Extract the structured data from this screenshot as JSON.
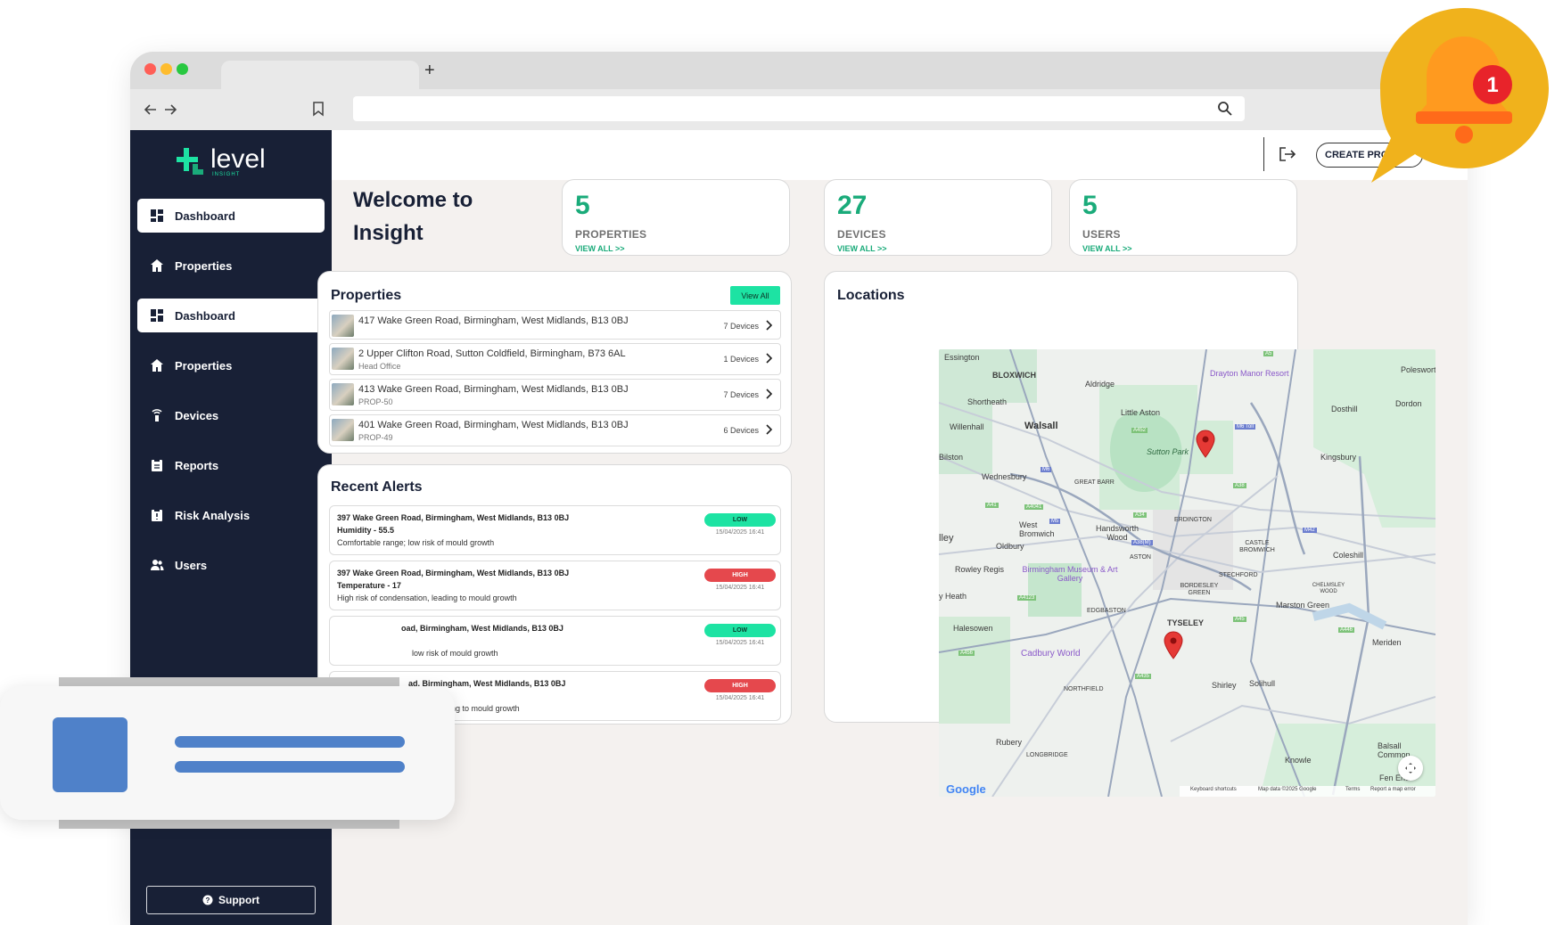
{
  "browser": {
    "new_tab_symbol": "+"
  },
  "brand": {
    "name": "level",
    "tagline": "INSIGHT"
  },
  "sidebar": {
    "items": [
      {
        "label": "Dashboard",
        "icon": "grid-icon",
        "active": true
      },
      {
        "label": "Properties",
        "icon": "home-icon",
        "active": false
      },
      {
        "label": "Dashboard",
        "icon": "grid-icon",
        "active": true
      },
      {
        "label": "Properties",
        "icon": "home-icon",
        "active": false
      },
      {
        "label": "Devices",
        "icon": "device-icon",
        "active": false
      },
      {
        "label": "Reports",
        "icon": "report-icon",
        "active": false
      },
      {
        "label": "Risk Analysis",
        "icon": "risk-icon",
        "active": false
      },
      {
        "label": "Users",
        "icon": "users-icon",
        "active": false
      }
    ],
    "support_label": "Support"
  },
  "header": {
    "create_label": "CREATE PRO"
  },
  "welcome": {
    "line1": "Welcome to",
    "line2": "Insight"
  },
  "stats": [
    {
      "value": "5",
      "label": "PROPERTIES",
      "link": "VIEW ALL >>"
    },
    {
      "value": "27",
      "label": "DEVICES",
      "link": "VIEW ALL >>"
    },
    {
      "value": "5",
      "label": "USERS",
      "link": "VIEW ALL >>"
    }
  ],
  "properties": {
    "title": "Properties",
    "view_all": "View All",
    "rows": [
      {
        "address": "417 Wake Green Road, Birmingham, West Midlands, B13 0BJ",
        "sub": "",
        "devices": "7 Devices"
      },
      {
        "address": "2 Upper Clifton Road, Sutton Coldfield, Birmingham, B73 6AL",
        "sub": "Head Office",
        "devices": "1 Devices"
      },
      {
        "address": "413 Wake Green Road, Birmingham, West Midlands, B13 0BJ",
        "sub": "PROP-50",
        "devices": "7 Devices"
      },
      {
        "address": "401 Wake Green Road, Birmingham, West Midlands, B13 0BJ",
        "sub": "PROP-49",
        "devices": "6 Devices"
      }
    ]
  },
  "alerts": {
    "title": "Recent Alerts",
    "rows": [
      {
        "address": "397 Wake Green Road, Birmingham, West Midlands, B13 0BJ",
        "measure": "Humidity - 55.5",
        "desc": "Comfortable range; low risk of mould growth",
        "severity": "LOW",
        "time": "15/04/2025 16:41"
      },
      {
        "address": "397 Wake Green Road, Birmingham, West Midlands, B13 0BJ",
        "measure": "Temperature - 17",
        "desc": "High risk of condensation, leading to mould growth",
        "severity": "HIGH",
        "time": "15/04/2025 16:41"
      },
      {
        "address": "oad, Birmingham, West Midlands, B13 0BJ",
        "measure": "",
        "desc": "low risk of mould growth",
        "severity": "LOW",
        "time": "15/04/2025 16:41"
      },
      {
        "address": "ad, Birmingham, West Midlands, B13 0BJ",
        "measure": "",
        "desc": "sation, leading to mould growth",
        "severity": "HIGH",
        "time": "15/04/2025 16:41"
      }
    ]
  },
  "locations": {
    "title": "Locations",
    "map_labels": [
      "Essington",
      "BLOXWICH",
      "Walsall",
      "Aldridge",
      "Drayton Manor Resort",
      "Poleswort",
      "Shortheath",
      "Little Aston",
      "Dosthill",
      "Dordon",
      "Willenhall",
      "Sutton Park",
      "Bilston",
      "Wednesbury",
      "GREAT BARR",
      "Kingsbury",
      "West Bromwich",
      "Handsworth Wood",
      "ERDINGTON",
      "lley",
      "Oldbury",
      "ASTON",
      "CASTLE BROMWICH",
      "Coleshill",
      "Rowley Regis",
      "Birmingham Museum & Art Gallery",
      "STECHFORD",
      "BORDESLEY GREEN",
      "CHELMSLEY WOOD",
      "y Heath",
      "EDGBASTON",
      "Marston Green",
      "Halesowen",
      "TYSELEY",
      "Meriden",
      "Cadbury World",
      "NORTHFIELD",
      "Shirley",
      "Solihull",
      "Rubery",
      "LONGBRIDGE",
      "Knowle",
      "Balsall Common",
      "Fen End",
      "Google",
      "Keyboard shortcuts",
      "Map data ©2025 Google",
      "Terms",
      "Report a map error"
    ],
    "road_labels": [
      "A452",
      "M6 Toll",
      "A38",
      "M6",
      "A34",
      "M5",
      "A41",
      "A4041",
      "A456",
      "A435",
      "A45",
      "M42",
      "A446",
      "A4123",
      "A38(M)",
      "A5"
    ]
  },
  "notification": {
    "count": "1"
  },
  "colors": {
    "accent": "#1aab7a",
    "sidebar": "#182036",
    "low": "#1de3a3",
    "high": "#e5484d",
    "bell": "#f0b21c"
  }
}
